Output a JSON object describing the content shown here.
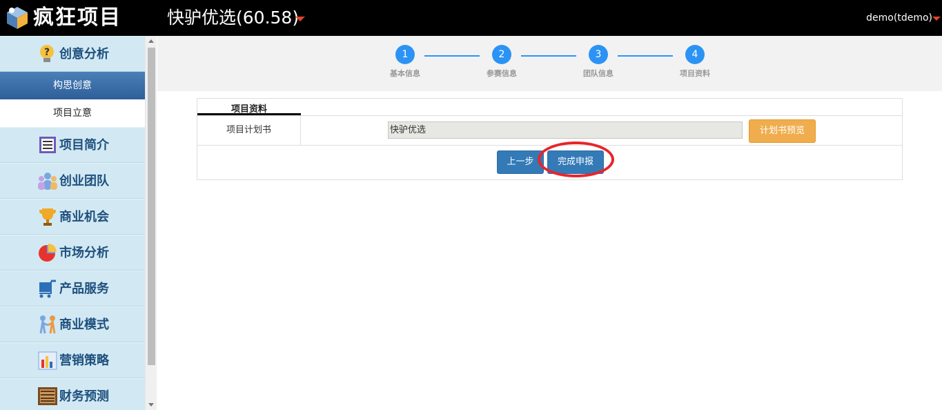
{
  "header": {
    "logo_text": "疯狂项目",
    "project_title": "快驴优选(60.58)",
    "user": "demo(tdemo)"
  },
  "sidebar": {
    "categories": [
      {
        "label": "创意分析",
        "icon": "lightbulb-question-icon"
      },
      {
        "label": "项目简介",
        "icon": "document-icon"
      },
      {
        "label": "创业团队",
        "icon": "team-people-icon"
      },
      {
        "label": "商业机会",
        "icon": "trophy-icon"
      },
      {
        "label": "市场分析",
        "icon": "pie-chart-icon"
      },
      {
        "label": "产品服务",
        "icon": "cart-icon"
      },
      {
        "label": "商业模式",
        "icon": "handshake-people-icon"
      },
      {
        "label": "营销策略",
        "icon": "bar-chart-icon"
      },
      {
        "label": "财务预测",
        "icon": "abacus-icon"
      }
    ],
    "subitems": [
      {
        "label": "构思创意",
        "active": true
      },
      {
        "label": "项目立意",
        "active": false
      }
    ]
  },
  "steps": [
    {
      "number": "1",
      "label": "基本信息"
    },
    {
      "number": "2",
      "label": "参赛信息"
    },
    {
      "number": "3",
      "label": "团队信息"
    },
    {
      "number": "4",
      "label": "项目资料"
    }
  ],
  "form": {
    "tab_label": "项目资料",
    "row_label": "项目计划书",
    "file_value": "快驴优选",
    "preview_label": "计划书预览",
    "prev_label": "上一步",
    "submit_label": "完成申报"
  },
  "colors": {
    "step_blue": "#2c93f5",
    "button_blue": "#337ab7",
    "button_orange": "#f0ad4e",
    "highlight_red": "#e8252b",
    "caret_red": "#e0442a"
  }
}
